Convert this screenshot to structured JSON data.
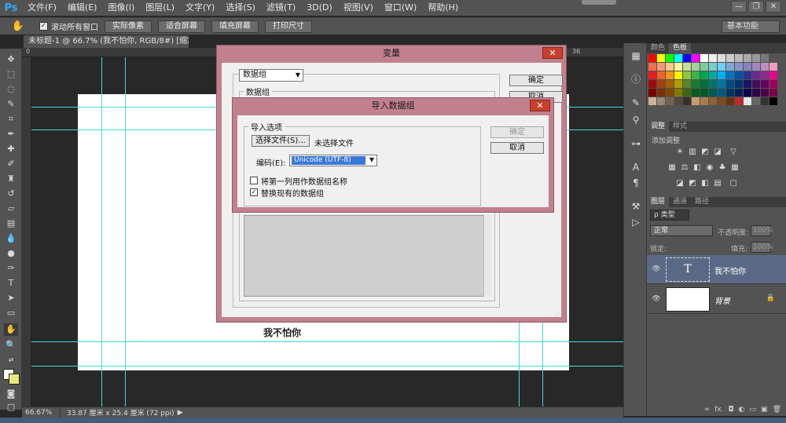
{
  "app": {
    "logo": "Ps",
    "menu": [
      "文件(F)",
      "编辑(E)",
      "图像(I)",
      "图层(L)",
      "文字(Y)",
      "选择(S)",
      "滤镜(T)",
      "3D(D)",
      "视图(V)",
      "窗口(W)",
      "帮助(H)"
    ],
    "window_controls": [
      "—",
      "❐",
      "✕"
    ]
  },
  "options_bar": {
    "scroll_all_label": "滚动所有窗口",
    "scroll_all_checked": "✓",
    "buttons": [
      "实际像素",
      "适合屏幕",
      "填充屏幕",
      "打印尺寸"
    ],
    "workspace": "基本功能"
  },
  "document": {
    "tab_title": "未标题-1 @ 66.7% (我不怕你, RGB/8#) [缩放后] *",
    "tab_close": "×",
    "canvas_text": "我不怕你",
    "ruler_marks": [
      "0",
      "36"
    ]
  },
  "status_bar": {
    "zoom": "66.67%",
    "doc_info": "33.87 厘米 x 25.4 厘米 (72 ppi)"
  },
  "panels": {
    "color_tabs": [
      "颜色",
      "色板"
    ],
    "adjust_tabs": [
      "调整",
      "样式"
    ],
    "adjust_title": "添加调整",
    "layer_tabs": [
      "图层",
      "通道",
      "路径"
    ],
    "filter_kind": "ρ 类型",
    "blend_mode": "正常",
    "opacity_label": "不透明度:",
    "opacity_value": "100%",
    "lock_label": "锁定:",
    "fill_label": "填充:",
    "fill_value": "100%",
    "layers": [
      {
        "name": "我不怕你",
        "thumb": "T"
      },
      {
        "name": "背景",
        "lock": "🔒"
      }
    ],
    "footer_icons": [
      "∞",
      "fx.",
      "◘",
      "◐",
      "▭",
      "▣",
      "🗑"
    ]
  },
  "variables_dialog": {
    "title": "变量",
    "close": "✕",
    "define_select": "数据组",
    "group_label": "数据组",
    "ok": "确定",
    "cancel": "取消"
  },
  "import_dialog": {
    "title": "导入数据组",
    "close": "✕",
    "options_label": "导入选项",
    "choose_file": "选择文件(S)...",
    "file_status": "未选择文件",
    "encoding_label": "编码(E):",
    "encoding_value": "Unicode (UTF-8)",
    "first_column_label": "将第一列用作数据组名称",
    "first_column_checked": "",
    "replace_label": "替换现有的数据组",
    "replace_checked": "✓",
    "ok": "确定",
    "cancel": "取消"
  },
  "colors": {
    "dialog_frame": "#c2808f",
    "guide": "#46d7d7",
    "selected_layer": "#5a6a86",
    "encoding_highlight": "#3a78d8",
    "swatches": [
      "#ff0000",
      "#ffff00",
      "#00ff00",
      "#00ffff",
      "#0000ff",
      "#ff00ff",
      "#ffffff",
      "#eeeeee",
      "#dddddd",
      "#cccccc",
      "#bbbbbb",
      "#aaaaaa",
      "#999999",
      "#777777",
      "#555555",
      "#f26c4f",
      "#f69679",
      "#fdc689",
      "#fff799",
      "#c4df9b",
      "#a3d39c",
      "#82ca9d",
      "#7bcdc8",
      "#6ecff6",
      "#7ea7d8",
      "#8493ca",
      "#8882be",
      "#a187be",
      "#bc8dbf",
      "#f49ac1",
      "#ed1c24",
      "#f26522",
      "#f7941d",
      "#fff200",
      "#8dc63f",
      "#39b54a",
      "#00a651",
      "#00a99d",
      "#00aeef",
      "#0072bc",
      "#0054a6",
      "#2e3192",
      "#662d91",
      "#92278f",
      "#ec008c",
      "#9e0b0f",
      "#a0410d",
      "#a36209",
      "#aba000",
      "#598527",
      "#1a7b30",
      "#007236",
      "#00746b",
      "#0076a3",
      "#004b80",
      "#003471",
      "#1b1464",
      "#440e62",
      "#630460",
      "#9e005d",
      "#790000",
      "#7b2e00",
      "#7d4900",
      "#827b00",
      "#406618",
      "#005e20",
      "#005826",
      "#005952",
      "#005b7f",
      "#003663",
      "#002157",
      "#0d004c",
      "#32004b",
      "#4b0049",
      "#7b0046",
      "#c7b299",
      "#998675",
      "#736357",
      "#534741",
      "#37302a",
      "#c69c6d",
      "#a67c52",
      "#8c6239",
      "#754c24",
      "#603913",
      "#c1272d",
      "#e6e6e6",
      "#666666",
      "#333333",
      "#000000"
    ]
  }
}
